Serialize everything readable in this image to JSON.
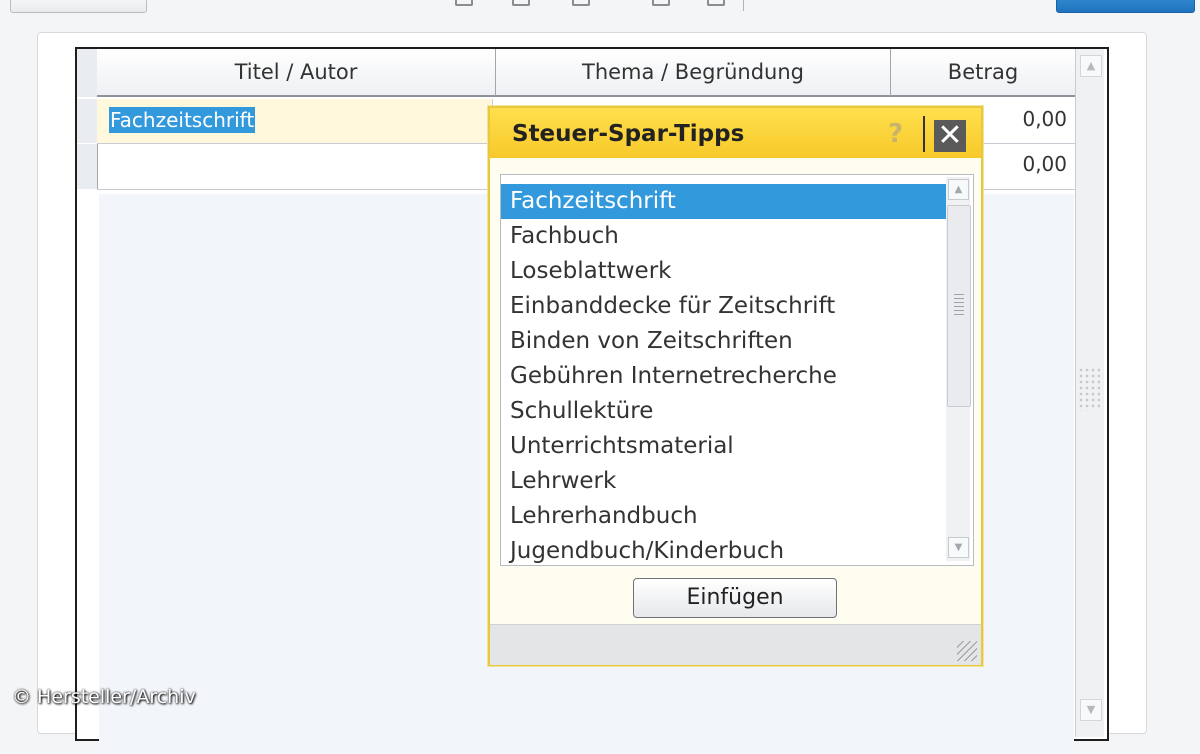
{
  "grid": {
    "headers": [
      "Titel / Autor",
      "Thema / Begründung",
      "Betrag"
    ],
    "rows": [
      {
        "title": "Fachzeitschrift",
        "amount": "0,00"
      },
      {
        "title": "",
        "amount": "0,00"
      }
    ]
  },
  "popup": {
    "title": "Steuer-Spar-Tipps",
    "help": "?",
    "close": "✕",
    "items": [
      "Fachzeitschrift",
      "Fachbuch",
      "Loseblattwerk",
      "Einbanddecke für Zeitschrift",
      "Binden von Zeitschriften",
      "Gebühren Internetrecherche",
      "Schullektüre",
      "Unterrichtsmaterial",
      "Lehrwerk",
      "Lehrerhandbuch",
      "Jugendbuch/Kinderbuch"
    ],
    "selected_index": 0,
    "insert_label": "Einfügen"
  },
  "watermark": "© Hersteller/Archiv",
  "colors": {
    "selection": "#3399dd",
    "popup_header": "#f7c92a",
    "primary_button": "#1f73bf"
  }
}
